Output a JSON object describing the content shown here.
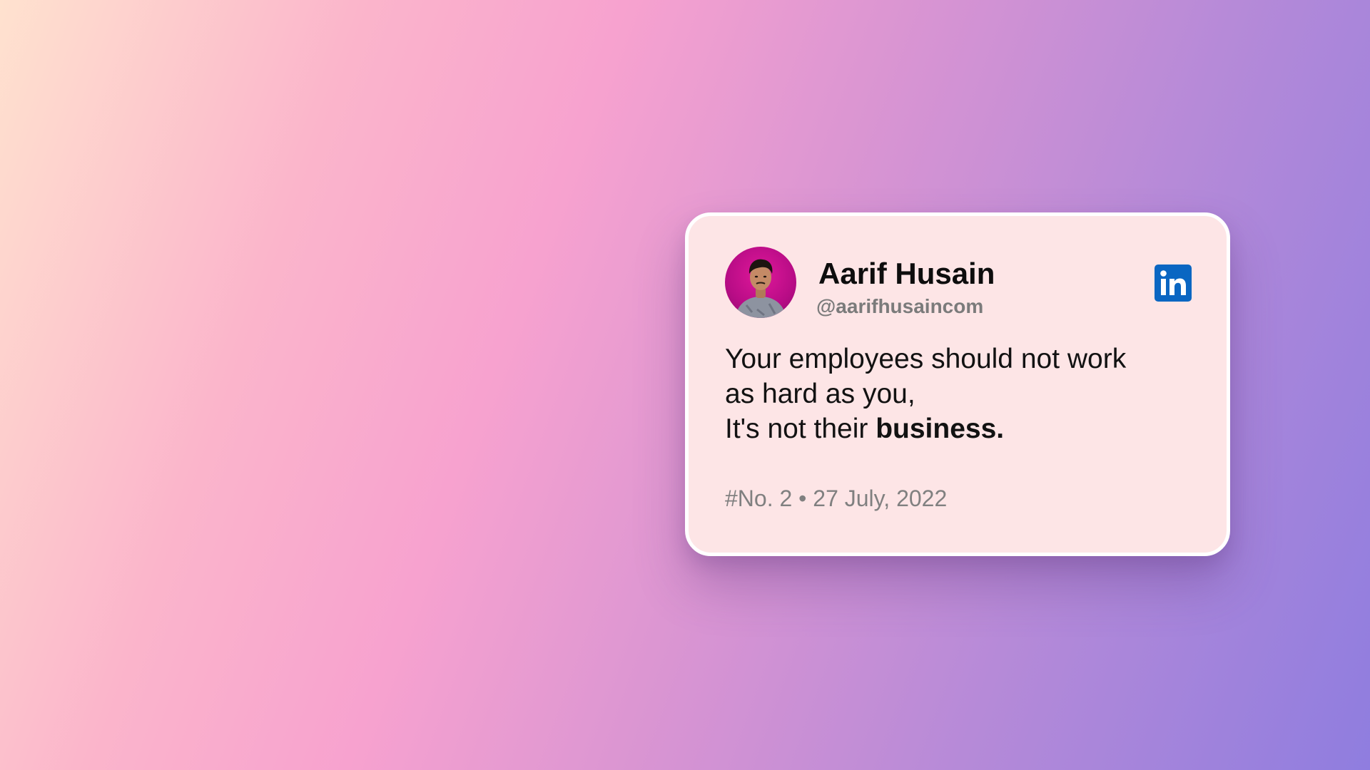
{
  "post": {
    "author_name": "Aarif Husain",
    "author_handle": "@aarifhusaincom",
    "platform_icon": "linkedin-icon",
    "quote_lines": [
      "Your employees should not work",
      "as hard as you,"
    ],
    "quote_last_prefix": "It's not their ",
    "quote_last_bold": "business.",
    "post_number": "#No. 2",
    "separator": " • ",
    "date": "27 July, 2022"
  },
  "colors": {
    "card_background": "#fde5e6",
    "linkedin_blue": "#0a66c2",
    "avatar_background": "#c0108a"
  }
}
